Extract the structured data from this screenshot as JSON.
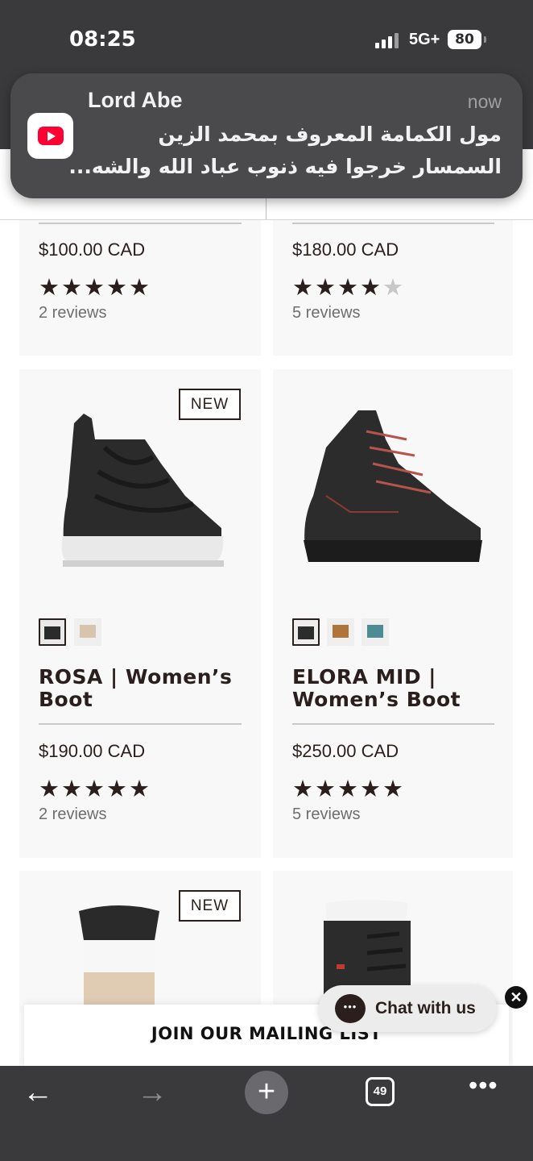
{
  "status_bar": {
    "time": "08:25",
    "network": "5G+",
    "battery": "80"
  },
  "notification": {
    "app_icon": "youtube-icon",
    "title": "Lord Abe",
    "time": "now",
    "line1": "مول الكمامة المعروف بمحمد الزين",
    "line2": "السمسار خرجوا فيه ذنوب عباد الله والشه..."
  },
  "products": [
    {
      "price": "$100.00 CAD",
      "rating": 5,
      "reviews": "2 reviews"
    },
    {
      "price": "$180.00 CAD",
      "rating": 4.5,
      "reviews": "5 reviews"
    },
    {
      "badge": "NEW",
      "name_line1": "ROSA | Women’s",
      "name_line2": "Boot",
      "price": "$190.00 CAD",
      "rating": 5,
      "reviews": "2 reviews",
      "swatches": 2
    },
    {
      "name_line1": "ELORA MID |",
      "name_line2": "Women’s Boot",
      "price": "$250.00 CAD",
      "rating": 5,
      "reviews": "5 reviews",
      "swatches": 3
    },
    {
      "badge": "NEW"
    },
    {}
  ],
  "mailing_list": {
    "label": "JOIN OUR MAILING LIST"
  },
  "chat": {
    "label": "Chat with us"
  },
  "toolbar": {
    "tab_count": "49"
  },
  "colors": {
    "brand_text": "#2a1f1c",
    "card_bg": "#f8f8f8",
    "chrome": "#3a3a3c"
  }
}
